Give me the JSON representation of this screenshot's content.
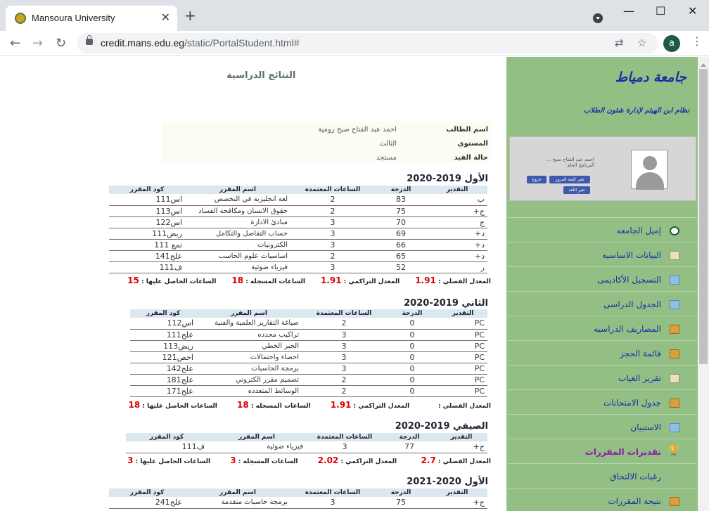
{
  "browser": {
    "tab_title": "Mansoura University",
    "tab_close": "✕",
    "new_tab": "+",
    "url_host": "credit.mans.edu.eg",
    "url_path": "/static/PortalStudent.html#",
    "account_initial": "a",
    "window_controls": {
      "minimize": "—",
      "maximize": "☐",
      "close": "✕"
    }
  },
  "page": {
    "title": "النتائج الدراسية"
  },
  "student": [
    {
      "label": "اسم الطالب",
      "value": "احمد عبد الفتاح صبح رومية"
    },
    {
      "label": "المستوي",
      "value": "الثالث"
    },
    {
      "label": "حالة القيد",
      "value": "مستجد"
    }
  ],
  "columns": [
    "التقدير",
    "الدرجة",
    "الساعات المعتمدة",
    "اسم المقرر",
    "كود المقرر"
  ],
  "semesters": [
    {
      "title": "الأول 2019-2020",
      "rows": [
        [
          "ب",
          "83",
          "2",
          "لغة انجليزية في التخصص",
          "اس111"
        ],
        [
          "ج+",
          "75",
          "2",
          "حقوق الانسان ومكافحة الفساد",
          "اس113"
        ],
        [
          "ج",
          "70",
          "3",
          "مبادئ الادارة",
          "اس122"
        ],
        [
          "د+",
          "69",
          "3",
          "حساب التفاضل والتكامل",
          "ريض111"
        ],
        [
          "د+",
          "66",
          "3",
          "الكترونيات",
          "تمع 111"
        ],
        [
          "د+",
          "65",
          "2",
          "اساسيات علوم الحاسب",
          "علح141"
        ],
        [
          "ر",
          "52",
          "3",
          "فيزياء ضوئية",
          "ف111"
        ]
      ],
      "summary": {
        "gpa_label": "المعدل الفصلي :",
        "gpa": "1.91",
        "cgpa_label": "المعدل التراكمي :",
        "cgpa": "1.91",
        "reg_label": "الساعات المسجله :",
        "reg": "18",
        "earned_label": "الساعات الحاصل عليها :",
        "earned": "15"
      }
    },
    {
      "title": "الثاني 2019-2020",
      "rows": [
        [
          "PC",
          "0",
          "2",
          "صياغة التقارير العلمية والفنية",
          "اس112"
        ],
        [
          "PC",
          "0",
          "3",
          "تراكيب محدده",
          "علح111"
        ],
        [
          "PC",
          "0",
          "3",
          "الجبر الخطي",
          "ريض113"
        ],
        [
          "PC",
          "0",
          "3",
          "احصاء واحتمالات",
          "احص121"
        ],
        [
          "PC",
          "0",
          "3",
          "برمجة الحاسبات",
          "علح142"
        ],
        [
          "PC",
          "0",
          "2",
          "تصميم مقرر الكتروني",
          "علح181"
        ],
        [
          "PC",
          "0",
          "2",
          "الوسائط المتعدده",
          "علح171"
        ]
      ],
      "summary": {
        "gpa_label": "المعدل الفصلي :",
        "gpa": "",
        "cgpa_label": "المعدل التراكمي :",
        "cgpa": "1.91",
        "reg_label": "الساعات المسجله :",
        "reg": "18",
        "earned_label": "الساعات الحاصل عليها :",
        "earned": "18"
      }
    },
    {
      "title": "الصيفي 2019-2020",
      "rows": [
        [
          "ج+",
          "77",
          "3",
          "فيزياء ضوئية",
          "ف111"
        ]
      ],
      "summary": {
        "gpa_label": "المعدل الفصلي :",
        "gpa": "2.7",
        "cgpa_label": "المعدل التراكمي :",
        "cgpa": "2.02",
        "reg_label": "الساعات المسجله :",
        "reg": "3",
        "earned_label": "الساعات الحاصل عليها :",
        "earned": "3"
      }
    },
    {
      "title": "الأول 2020-2021",
      "rows": [
        [
          "ج+",
          "75",
          "3",
          "برمجة حاسبات متقدمة",
          "علح241"
        ]
      ]
    }
  ],
  "sidebar": {
    "title": "جامعة دمياط",
    "subtitle": "نظام ابن الهيثم لإدارة شئون الطلاب",
    "profile_name": "احمد عبد الفتاح صبح ...",
    "profile_program": "البرنامج العام",
    "btn_change_password": "تغير كلمة المرور",
    "btn_logout": "خروج",
    "btn_change_lang": "تغير اللغه",
    "items": [
      {
        "label": "إميل الجامعه",
        "icon": "at-icon"
      },
      {
        "label": "البيانات الاساسيه",
        "icon": "document-icon"
      },
      {
        "label": "التسجيل الأكاديمى",
        "icon": "window-icon"
      },
      {
        "label": "الجدول الدراسى",
        "icon": "window-icon"
      },
      {
        "label": "المصاريف الدراسيه",
        "icon": "folder-icon"
      },
      {
        "label": "قائمة الحجز",
        "icon": "folder-icon"
      },
      {
        "label": "تقرير الغياب",
        "icon": "document-icon"
      },
      {
        "label": "جدول الامتحانات",
        "icon": "folder-icon"
      },
      {
        "label": "الاستبيان",
        "icon": "window-icon"
      },
      {
        "label": "تقديرات المقررات",
        "icon": "trophy-icon"
      },
      {
        "label": "رغبات الالتحاق",
        "icon": ""
      },
      {
        "label": "نتيجة المقررات",
        "icon": "folder-icon"
      }
    ]
  }
}
